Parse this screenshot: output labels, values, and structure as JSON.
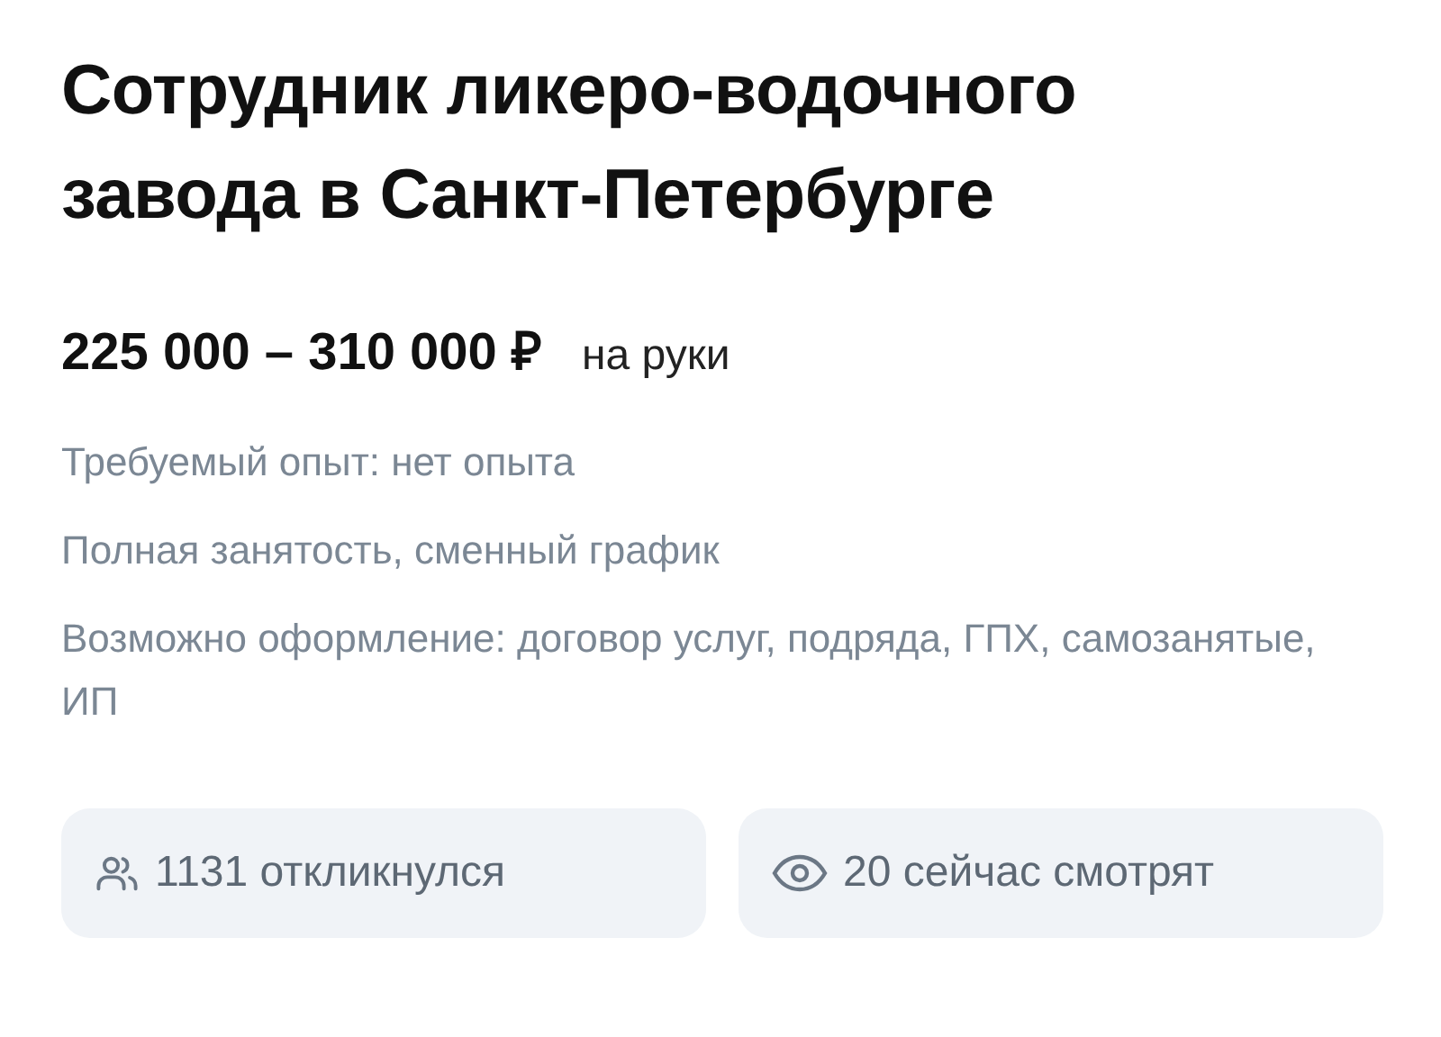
{
  "title": "Сотрудник ликеро-водочного завода в Санкт-Петербурге",
  "salary": {
    "amount": "225 000 – 310 000 ₽",
    "note": "на руки"
  },
  "details": [
    "Требуемый опыт: нет опыта",
    "Полная занятость, сменный график",
    "Возможно оформление: договор услуг, подряда, ГПХ, самозанятые, ИП"
  ],
  "stats": [
    {
      "kind": "responses",
      "text": "1131 откликнулся"
    },
    {
      "kind": "viewers",
      "text": "20 сейчас смотрят"
    }
  ]
}
